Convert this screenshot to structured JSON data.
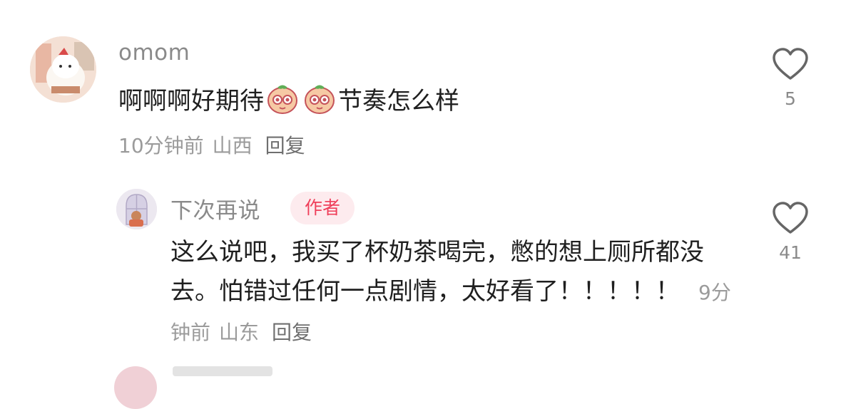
{
  "comments": [
    {
      "username": "omom",
      "text_before_emoji": "啊啊啊好期待",
      "text_after_emoji": "节奏怎么样",
      "emoji": [
        "peach-face-emoji",
        "peach-face-emoji"
      ],
      "time": "10分钟前",
      "location": "山西",
      "reply_label": "回复",
      "likes": "5"
    }
  ],
  "reply": {
    "username": "下次再说",
    "badge": "作者",
    "text": "这么说吧，我买了杯奶茶喝完，憋的想上厕所都没去。怕错过任何一点剧情，太好看了！！！！！",
    "time": "9分钟前",
    "location": "山东",
    "reply_label": "回复",
    "likes": "41"
  },
  "icons": {
    "like": "heart-outline-icon"
  },
  "colors": {
    "author_badge_bg": "#fdebee",
    "author_badge_text": "#ef3f5a",
    "meta_text": "#9b9b9b"
  }
}
